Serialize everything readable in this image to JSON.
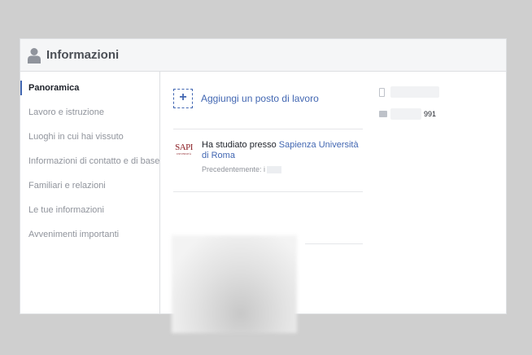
{
  "header": {
    "title": "Informazioni",
    "icon": "person-icon"
  },
  "sidebar": {
    "items": [
      {
        "label": "Panoramica",
        "active": true
      },
      {
        "label": "Lavoro e istruzione",
        "active": false
      },
      {
        "label": "Luoghi in cui hai vissuto",
        "active": false
      },
      {
        "label": "Informazioni di contatto e di base",
        "active": false
      },
      {
        "label": "Familiari e relazioni",
        "active": false
      },
      {
        "label": "Le tue informazioni",
        "active": false
      },
      {
        "label": "Avvenimenti importanti",
        "active": false
      }
    ]
  },
  "main": {
    "add_work": {
      "icon": "+",
      "label": "Aggiungi un posto di lavoro"
    },
    "education": {
      "logo_text": "SAPI",
      "logo_subtext": "UNIVERSITÀ",
      "prefix": "Ha studiato presso ",
      "school": "Sapienza Università di Roma",
      "previously": "Precedentemente: i"
    }
  },
  "contact": {
    "phone_icon": "phone-icon",
    "birthday_icon": "cake-icon",
    "birthday_visible_text": "991"
  },
  "colors": {
    "accent": "#4267b2",
    "muted": "#90949c",
    "border": "#dddfe2",
    "backdrop": "#cfcfcf"
  }
}
